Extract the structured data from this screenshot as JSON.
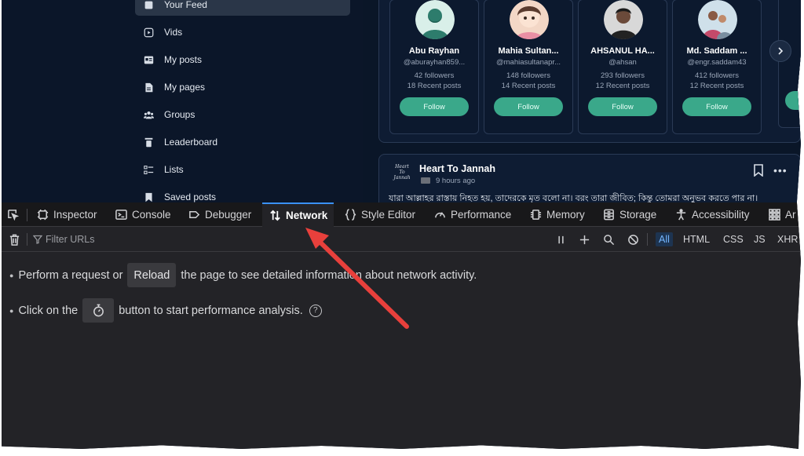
{
  "sidebar": {
    "items": [
      {
        "label": "Your Feed",
        "icon": "feed-icon"
      },
      {
        "label": "Vids",
        "icon": "video-icon"
      },
      {
        "label": "My posts",
        "icon": "posts-icon"
      },
      {
        "label": "My pages",
        "icon": "pages-icon"
      },
      {
        "label": "Groups",
        "icon": "groups-icon"
      },
      {
        "label": "Leaderboard",
        "icon": "leaderboard-icon"
      },
      {
        "label": "Lists",
        "icon": "lists-icon"
      },
      {
        "label": "Saved posts",
        "icon": "bookmark-icon"
      }
    ]
  },
  "suggestions": [
    {
      "name": "Abu Rayhan",
      "handle": "@aburayhan859...",
      "followers": "42 followers",
      "posts": "18 Recent posts",
      "button": "Follow"
    },
    {
      "name": "Mahia Sultan...",
      "handle": "@mahiasultanapr...",
      "followers": "148 followers",
      "posts": "14 Recent posts",
      "button": "Follow"
    },
    {
      "name": "AHSANUL HA...",
      "handle": "@ahsan",
      "followers": "293 followers",
      "posts": "12 Recent posts",
      "button": "Follow"
    },
    {
      "name": "Md. Saddam ...",
      "handle": "@engr.saddam43",
      "followers": "412 followers",
      "posts": "12 Recent posts",
      "button": "Follow"
    }
  ],
  "post": {
    "logo_line1": "Heart",
    "logo_line2": "To",
    "logo_line3": "Jannah",
    "author": "Heart To Jannah",
    "time": "9 hours ago",
    "text": "যারা আল্লাহর রাস্তায় নিহত হয়, তাদেরকে মৃত বলো না। বরং তারা জীবিত; কিন্তু তোমরা অনুভব করতে পার না।"
  },
  "devtools": {
    "tabs": [
      {
        "label": "Inspector",
        "icon": "inspector-icon"
      },
      {
        "label": "Console",
        "icon": "console-icon"
      },
      {
        "label": "Debugger",
        "icon": "debugger-icon"
      },
      {
        "label": "Network",
        "icon": "network-icon",
        "active": true
      },
      {
        "label": "Style Editor",
        "icon": "style-editor-icon"
      },
      {
        "label": "Performance",
        "icon": "performance-icon"
      },
      {
        "label": "Memory",
        "icon": "memory-icon"
      },
      {
        "label": "Storage",
        "icon": "storage-icon"
      },
      {
        "label": "Accessibility",
        "icon": "accessibility-icon"
      },
      {
        "label": "Ar",
        "icon": "application-icon"
      }
    ],
    "filter_placeholder": "Filter URLs",
    "type_filters": [
      "All",
      "HTML",
      "CSS",
      "JS",
      "XHR"
    ],
    "notice1_before": "Perform a request or",
    "notice1_button": "Reload",
    "notice1_after": "the page to see detailed information about network activity.",
    "notice2_before": "Click on the",
    "notice2_after": "button to start performance analysis.",
    "help_glyph": "?"
  },
  "colors": {
    "accent_follow": "#3aa88a",
    "active_tab_border": "#3a91f5",
    "annotation_arrow": "#e8403c"
  }
}
